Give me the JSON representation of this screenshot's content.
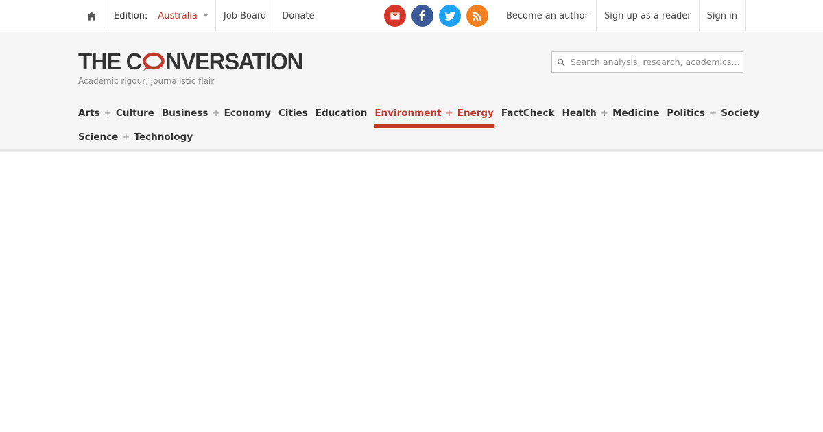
{
  "topbar": {
    "edition_label": "Edition:",
    "edition_value": "Australia",
    "links": [
      "Job Board",
      "Donate"
    ],
    "social": [
      {
        "name": "email-icon",
        "color": "#d8352a"
      },
      {
        "name": "facebook-icon",
        "color": "#3b5998"
      },
      {
        "name": "twitter-icon",
        "color": "#1da1f2"
      },
      {
        "name": "rss-icon",
        "color": "#f48120"
      }
    ],
    "account_links": [
      "Become an author",
      "Sign up as a reader",
      "Sign in"
    ]
  },
  "masthead": {
    "logo_text_left": "THE C",
    "logo_text_right": "NVERSATION",
    "tagline": "Academic rigour, journalistic flair",
    "search_placeholder": "Search analysis, research, academics…"
  },
  "nav": {
    "row1": [
      {
        "a": "Arts",
        "b": "Culture"
      },
      {
        "a": "Business",
        "b": "Economy"
      },
      {
        "a": "Cities"
      },
      {
        "a": "Education"
      },
      {
        "a": "Environment",
        "b": "Energy",
        "active": true
      },
      {
        "a": "FactCheck"
      },
      {
        "a": "Health",
        "b": "Medicine"
      },
      {
        "a": "Politics",
        "b": "Society"
      }
    ],
    "row2": [
      {
        "a": "Science",
        "b": "Technology"
      }
    ],
    "separator": "+"
  },
  "colors": {
    "accent": "#c0392b",
    "text": "#333333",
    "masthead_bg": "#f5f5f5"
  }
}
